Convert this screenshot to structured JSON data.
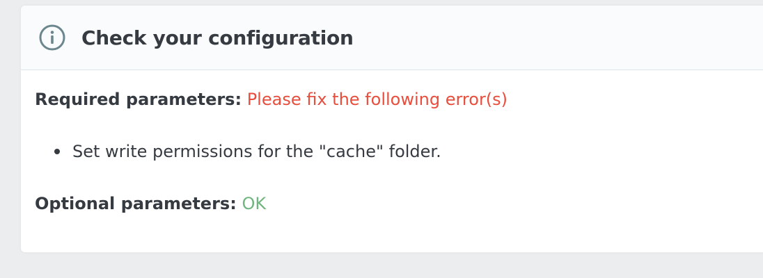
{
  "card": {
    "title": "Check your configuration",
    "icon": "info-circle-icon"
  },
  "required": {
    "label": "Required parameters:",
    "status_text": "Please fix the following error(s)",
    "status_color": "#e84e3d",
    "errors": [
      "Set write permissions for the \"cache\" folder."
    ]
  },
  "optional": {
    "label": "Optional parameters:",
    "status_text": "OK",
    "status_color": "#70b580"
  }
}
